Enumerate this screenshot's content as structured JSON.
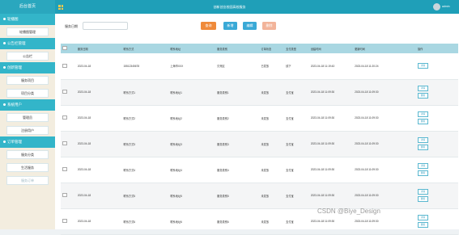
{
  "app": {
    "brand": "后台首页",
    "title": "创新创业校园高校服务",
    "user": "admin"
  },
  "sidebar": [
    {
      "header": "轮播图",
      "items": [
        {
          "label": "轮播图管理",
          "muted": false
        }
      ]
    },
    {
      "header": "公告栏管理",
      "items": [
        {
          "label": "公告栏",
          "muted": false
        }
      ]
    },
    {
      "header": "创新管理",
      "items": [
        {
          "label": "服务项目",
          "muted": false
        },
        {
          "label": "项目分类",
          "muted": false
        }
      ]
    },
    {
      "header": "系统用户",
      "items": [
        {
          "label": "管理员",
          "muted": false
        },
        {
          "label": "注册用户",
          "muted": false
        }
      ]
    },
    {
      "header": "订单管理",
      "items": [
        {
          "label": "服务分类",
          "muted": false
        },
        {
          "label": "生活服务",
          "muted": false
        },
        {
          "label": "服务订单",
          "muted": true
        }
      ]
    }
  ],
  "search": {
    "label": "服务日期",
    "value": "",
    "placeholder": ""
  },
  "buttons": [
    {
      "label": "查询",
      "color": "#ef8a3a"
    },
    {
      "label": "新增",
      "color": "#3aa9d6"
    },
    {
      "label": "编辑",
      "color": "#3aa9d6"
    },
    {
      "label": "删除",
      "color": "#f2b49a"
    }
  ],
  "table": {
    "columns": [
      "",
      "服务日期",
      "联系方式",
      "联系地址",
      "服务类别",
      "订单状态",
      "支付类型",
      "创建时间",
      "更新时间",
      "操作"
    ],
    "action_edit": "详情",
    "action_delete": "删除",
    "rows": [
      [
        "2023-04-18",
        "15512345678",
        "上海市XXX",
        "贝壳区",
        "已发放",
        "线下",
        "2023-04-18 11:19:43",
        "2023-04-18 11:20:24"
      ],
      [
        "2023-04-18",
        "联系方式1",
        "联系地址1",
        "服务类别1",
        "未发放",
        "支付宝",
        "2023-04-18 11:09:30",
        "2023-04-18 11:09:30"
      ],
      [
        "2023-04-18",
        "联系方式2",
        "联系地址2",
        "服务类别2",
        "未发放",
        "支付宝",
        "2023-04-18 11:09:30",
        "2023-04-18 11:09:30"
      ],
      [
        "2023-04-18",
        "联系方式3",
        "联系地址3",
        "服务类别3",
        "未发放",
        "支付宝",
        "2023-04-18 11:09:30",
        "2023-04-18 11:09:30"
      ],
      [
        "2023-04-18",
        "联系方式4",
        "联系地址4",
        "服务类别4",
        "未发放",
        "支付宝",
        "2023-04-18 11:09:30",
        "2023-04-18 11:09:30"
      ],
      [
        "2023-04-18",
        "联系方式5",
        "联系地址5",
        "服务类别5",
        "未发放",
        "支付宝",
        "2023-04-18 11:09:30",
        "2023-04-18 11:09:30"
      ],
      [
        "2023-04-18",
        "联系方式6",
        "联系地址6",
        "服务类别6",
        "未发放",
        "支付宝",
        "2023-04-18 11:09:30",
        "2023-04-18 11:09:30"
      ]
    ]
  },
  "watermark": "CSDN @Biye_Design"
}
